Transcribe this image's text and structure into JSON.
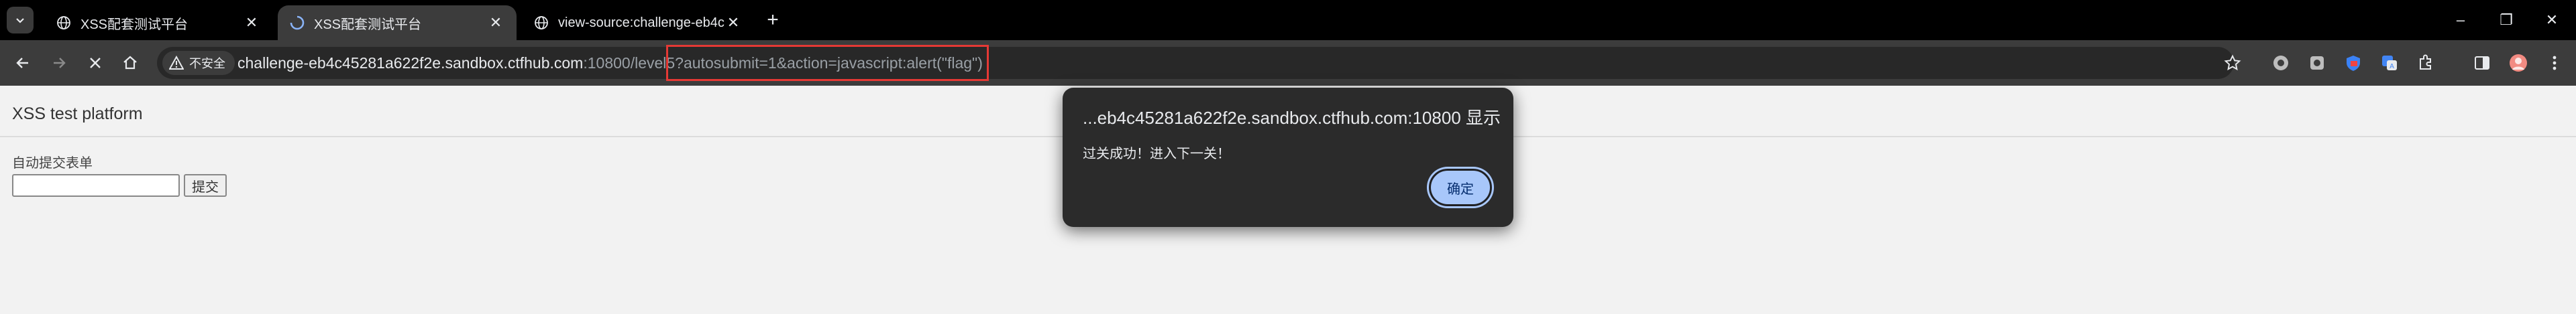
{
  "browser": {
    "tabs": [
      {
        "title": "XSS配套测试平台",
        "active": false
      },
      {
        "title": "XSS配套测试平台",
        "active": true
      },
      {
        "title": "view-source:challenge-eb4c4",
        "active": false
      }
    ],
    "new_tab_label": "+",
    "window_controls": {
      "minimize": "–",
      "restore": "❐",
      "close": "✕"
    },
    "security_label": "不安全",
    "url": {
      "host": "challenge-eb4c45281a622f2e.sandbox.ctfhub.com",
      "rest": ":10800/level5?autosubmit=1&action=javascript:alert(\"flag\")"
    },
    "colors": {
      "tab_strip": "#000000",
      "toolbar": "#3c3c3c",
      "omnibox": "#282828",
      "highlight_box": "#e53935",
      "dialog_bg": "#2b2b2b",
      "dialog_button": "#a8c7fa"
    },
    "extensions": [
      "circle-icon",
      "puzzle-box-icon",
      "shield-icon",
      "translate-icon",
      "extensions-icon",
      "side-panel-icon",
      "profile-avatar",
      "more-menu-icon"
    ]
  },
  "page": {
    "site_title": "XSS test platform",
    "form": {
      "label": "自动提交表单",
      "input_value": "",
      "submit_label": "提交"
    }
  },
  "dialog": {
    "title": "...eb4c45281a622f2e.sandbox.ctfhub.com:10800 显示",
    "message": "过关成功！进入下一关！",
    "ok_label": "确定"
  }
}
